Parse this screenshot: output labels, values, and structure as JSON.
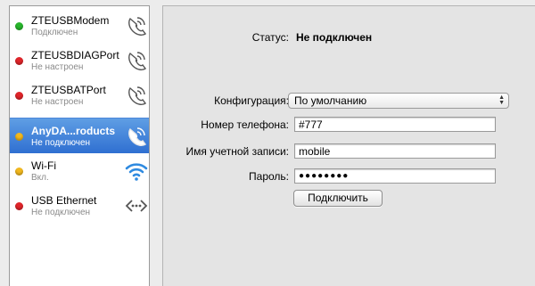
{
  "services": [
    {
      "name": "ZTEUSBModem",
      "status": "Подключен",
      "dot_color": "#28b62c",
      "icon": "phone-modem-icon",
      "selected": false
    },
    {
      "name": "ZTEUSBDIAGPort",
      "status": "Не настроен",
      "dot_color": "#e0252a",
      "icon": "phone-modem-icon",
      "selected": false
    },
    {
      "name": "ZTEUSBATPort",
      "status": "Не настроен",
      "dot_color": "#e0252a",
      "icon": "phone-modem-icon",
      "selected": false
    },
    {
      "name": "AnyDA...roducts",
      "status": "Не подключен",
      "dot_color": "#f2b81e",
      "icon": "phone-modem-icon",
      "selected": true
    },
    {
      "name": "Wi-Fi",
      "status": "Вкл.",
      "dot_color": "#f2b81e",
      "icon": "wifi-icon",
      "selected": false
    },
    {
      "name": "USB Ethernet",
      "status": "Не подключен",
      "dot_color": "#e0252a",
      "icon": "ethernet-icon",
      "selected": false
    }
  ],
  "detail": {
    "status_label": "Статус:",
    "status_value": "Не подключен",
    "config_label": "Конфигурация:",
    "config_value": "По умолчанию",
    "phone_label": "Номер телефона:",
    "phone_value": "#777",
    "account_label": "Имя учетной записи:",
    "account_value": "mobile",
    "password_label": "Пароль:",
    "password_value": "●●●●●●●●",
    "connect_label": "Подключить"
  },
  "colors": {
    "selection": "#3b7bd8",
    "status_connected": "#28b62c",
    "status_error": "#e0252a",
    "status_warning": "#f2b81e"
  }
}
